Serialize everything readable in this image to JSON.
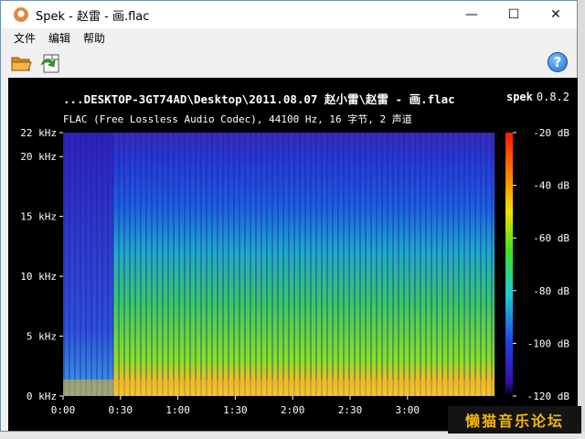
{
  "window": {
    "title": "Spek - 赵雷  - 画.flac",
    "minimize": "—",
    "maximize": "☐",
    "close": "✕"
  },
  "menu": [
    "文件",
    "编辑",
    "帮助"
  ],
  "toolbar": {
    "open_icon": "folder-open-icon",
    "save_icon": "save-icon",
    "help_icon": "help-icon",
    "help_label": "?"
  },
  "spek": {
    "file_path": "...DESKTOP-3GT74AD\\Desktop\\2011.08.07 赵小雷\\赵雷  - 画.flac",
    "app_name": "spek",
    "version": "0.8.2",
    "info": "FLAC (Free Lossless Audio Codec), 44100 Hz, 16 字节, 2 声道",
    "freq_ticks": [
      "0 kHz",
      "5 kHz",
      "10 kHz",
      "15 kHz",
      "20 kHz",
      "22 kHz"
    ],
    "time_ticks": [
      "0:00",
      "0:30",
      "1:00",
      "1:30",
      "2:00",
      "2:30",
      "3:00"
    ],
    "db_ticks": [
      "-20 dB",
      "-40 dB",
      "-60 dB",
      "-80 dB",
      "-100 dB",
      "-120 dB"
    ]
  },
  "watermark": "懒猫音乐论坛"
}
